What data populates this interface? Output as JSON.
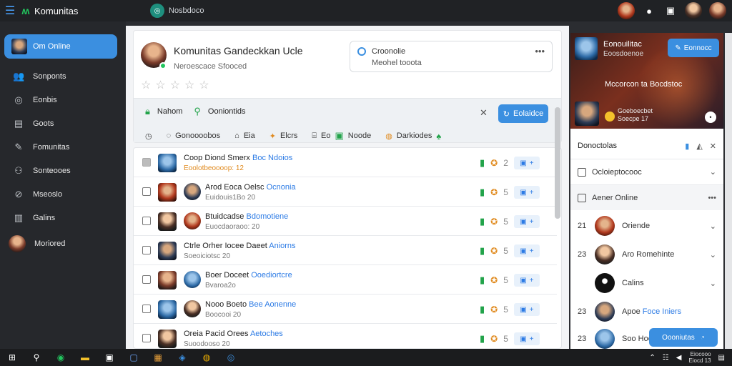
{
  "app": {
    "title": "Komunitas",
    "search_label": "Nosbdoco"
  },
  "topbar": {
    "icons": [
      "hamburger-menu-icon",
      "app-logo-icon",
      "chat-icon",
      "screen-icon"
    ]
  },
  "sidebar": {
    "active": "Om Online",
    "items": [
      {
        "label": "Sonponts",
        "icon": "users-icon"
      },
      {
        "label": "Eonbis",
        "icon": "target-icon"
      },
      {
        "label": "Goots",
        "icon": "list-icon"
      },
      {
        "label": "Fomunitas",
        "icon": "edit-icon"
      },
      {
        "label": "Sonteooes",
        "icon": "group-icon"
      },
      {
        "label": "Mseoslo",
        "icon": "compass-icon"
      },
      {
        "label": "Galins",
        "icon": "building-icon"
      },
      {
        "label": "Moriored",
        "icon": "avatar"
      }
    ]
  },
  "profile": {
    "title": "Komunitas Gandeckkan Ucle",
    "subtitle": "Neroescace Sfooced",
    "rating": 0,
    "info_title": "Croonolie",
    "info_sub": "Meohel tooota",
    "tab_a": "Nahom",
    "tab_b": "Ooniontids",
    "action_button": "Eolaidce",
    "filters": [
      "Gonoooobos",
      "Eia",
      "Elcrs",
      "Eo",
      "Noode",
      "Darkiodes"
    ]
  },
  "list": {
    "rows": [
      {
        "name": "Coop Diond Smerx",
        "link": "Boc Ndoios",
        "meta": "Eoolotbeoooop: 12",
        "meta_orange": true,
        "count": "2",
        "checked": true
      },
      {
        "name": "Arod Eoca Oelsc",
        "link": "Ocnonia",
        "meta": "Euidouis1Bo  20",
        "meta_orange": false,
        "count": "5",
        "checked": false
      },
      {
        "name": "Btuidcadse",
        "link": "Bdomotiene",
        "meta": "Euocdaoraoo: 20",
        "meta_orange": false,
        "count": "5",
        "checked": false
      },
      {
        "name": "Ctrle Orher Iocee Daeet",
        "link": "Aniorns",
        "meta": "Soeoiciotsc 20",
        "meta_orange": false,
        "count": "5",
        "checked": false
      },
      {
        "name": "Boer Doceet",
        "link": "Ooediortcre",
        "meta": "Bvaroa2o",
        "meta_orange": false,
        "count": "5",
        "checked": false
      },
      {
        "name": "Nooo Boeto",
        "link": "Bee Aonenne",
        "meta": "Boocooi 20",
        "meta_orange": false,
        "count": "5",
        "checked": false
      },
      {
        "name": "Oreia Pacid Orees",
        "link": "Aetoches",
        "meta": "Suoodooso 20",
        "meta_orange": false,
        "count": "5",
        "checked": false
      }
    ]
  },
  "right_panel": {
    "hero_title": "Eonouilitac",
    "hero_sub": "Eoosdoenoe",
    "hero_button": "Eonnocc",
    "hero_mid": "Mccorcon ta Bocdstoc",
    "hero_stats": [
      "Goeboecbet",
      "Soecpe 17"
    ],
    "header": "Donoctolas",
    "section_1": "Ocloieptocooc",
    "section_2": "Aener Online",
    "users": [
      {
        "num": "21",
        "name": "Oriende",
        "link": ""
      },
      {
        "num": "23",
        "name": "Aro Romehinte",
        "link": ""
      },
      {
        "num": "",
        "name": "Calins",
        "link": ""
      },
      {
        "num": "23",
        "name": "Apoe",
        "link": "Foce Iniers"
      },
      {
        "num": "23",
        "name": "Soo Hoe",
        "link": ""
      }
    ],
    "float_button": "Oooniutas"
  },
  "taskbar": {
    "icons": [
      "windows-start-icon",
      "search-icon",
      "chrome-icon",
      "folder-icon",
      "store-icon",
      "window-icon",
      "app-icon",
      "browser-icon",
      "edge-icon"
    ],
    "clock": [
      "Eiocooo",
      "Eiocd 13"
    ]
  }
}
